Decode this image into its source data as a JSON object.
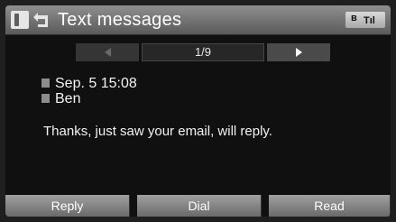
{
  "header": {
    "title": "Text messages",
    "phone_icon": "phone-icon",
    "back_icon": "back-icon",
    "status": {
      "bluetooth": "ʙ",
      "signal": "Tıl"
    }
  },
  "pager": {
    "counter": "1/9",
    "prev_icon": "triangle-left-icon",
    "next_icon": "triangle-right-icon"
  },
  "message": {
    "date": "Sep. 5 15:08",
    "sender": "Ben",
    "body": "Thanks, just saw your email, will reply."
  },
  "softkeys": {
    "reply": "Reply",
    "dial": "Dial",
    "read": "Read"
  }
}
